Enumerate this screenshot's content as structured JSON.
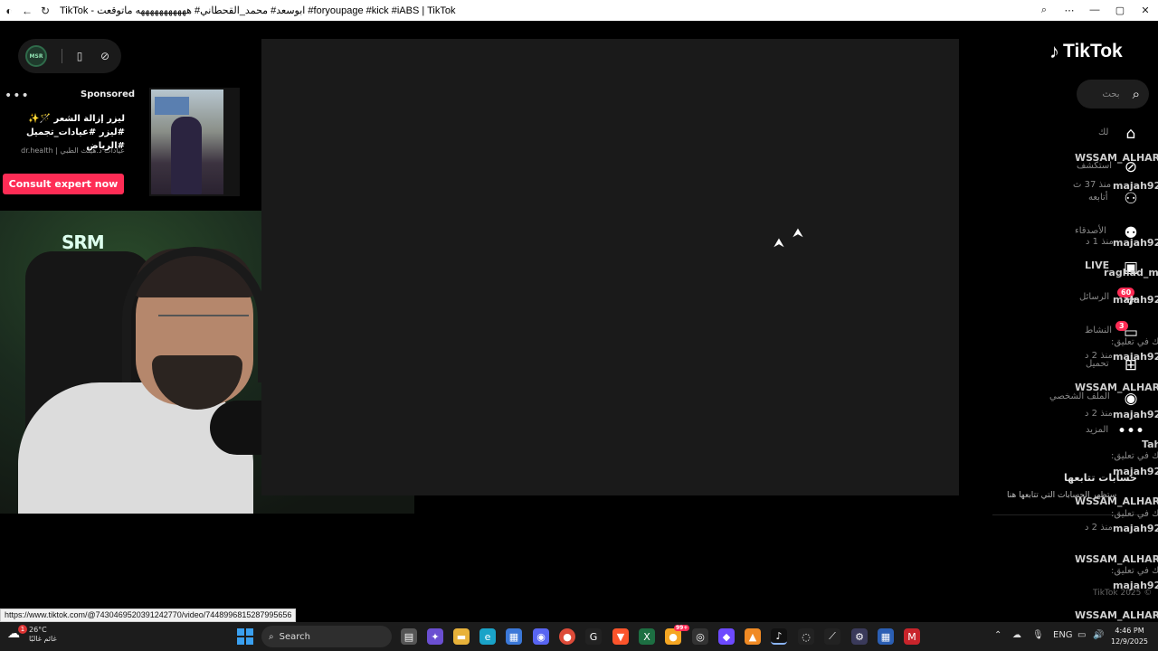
{
  "window": {
    "title": "TikTok - ابوسعد# محمد_القحطاني# هههههههههههه ماتوقعت #foryoupage #kick #iABS | TikTok",
    "controls": {
      "minimize": "—",
      "maximize": "▢",
      "close": "✕"
    }
  },
  "profile_pill": {
    "avatar_text": "MSR"
  },
  "ad": {
    "sponsored_label": "Sponsored",
    "title": "ليزر إزالة الشعر 🪄✨ #ليزر #عيادات_تجميل #الرياض",
    "subtitle": "عيادات د.هيلث الطبي | dr.health",
    "cta": "Consult expert now",
    "more": "•••"
  },
  "webcam": {
    "overlay_logo": "SRM"
  },
  "tiktok": {
    "brand": "TikTok",
    "search_placeholder": "بحث",
    "nav": [
      {
        "icon": "home-icon",
        "glyph": "⌂"
      },
      {
        "icon": "explore-icon",
        "glyph": "⊘"
      },
      {
        "icon": "following-icon",
        "glyph": "⚇"
      },
      {
        "icon": "friends-icon",
        "glyph": "⚉"
      },
      {
        "icon": "live-icon",
        "glyph": "▣"
      },
      {
        "icon": "messages-icon",
        "glyph": "✈"
      },
      {
        "icon": "activity-icon",
        "glyph": "▭"
      },
      {
        "icon": "upload-icon",
        "glyph": "⊞"
      },
      {
        "icon": "profile-icon",
        "glyph": "◉"
      },
      {
        "icon": "more-icon",
        "glyph": "•••"
      }
    ],
    "badges": {
      "messages": "60",
      "activity": "3"
    },
    "ghost_text": {
      "for_you": "لك",
      "explore": "استكشف",
      "following": "أتابعه",
      "friends": "الأصدقاء",
      "live": "LIVE",
      "messages": "الرسائل",
      "activity": "النشاط",
      "upload": "تحميل",
      "profile": "الملف الشخصي",
      "more": "المزيد",
      "user1": "WSSAM_ALHARE",
      "user2": "raghad_m9",
      "user3": "Tah",
      "handle": "majah92@",
      "comment": "كرك في تعليق:",
      "time1": "منذ 37 ث",
      "time2": "منذ 1 د",
      "time3": "منذ 2 د"
    },
    "following_title": "حسابات تتابعها",
    "following_sub": "ستظهر الحسابات التي تتابعها هنا",
    "copyright": "TikTok 2025 ©"
  },
  "status_url": "https://www.tiktok.com/@7430469520391242770/video/7448996815287995656",
  "taskbar": {
    "weather_temp": "26°C",
    "weather_desc": "غائم غالبًا",
    "weather_badge": "1",
    "search_label": "Search",
    "language": "ENG",
    "time": "4:46 PM",
    "date": "12/9/2025",
    "app_badge": "99+"
  }
}
